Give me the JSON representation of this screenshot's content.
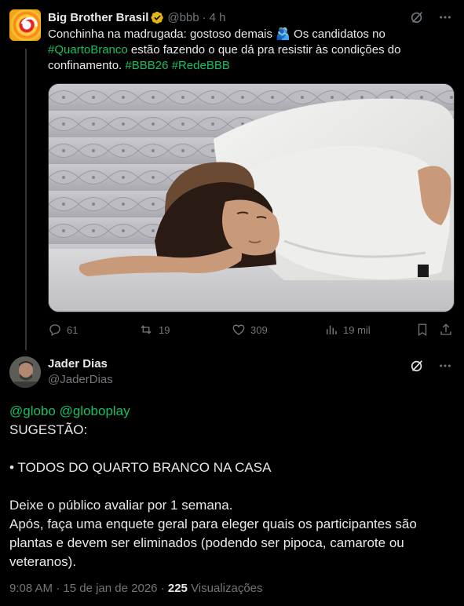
{
  "colors": {
    "background": "#000000",
    "text": "#e7e9ea",
    "muted": "#71767b",
    "hashtag": "#17bf63",
    "verified": "#e7b416"
  },
  "original_post": {
    "author_name": "Big Brother Brasil",
    "handle": "@bbb",
    "separator": "·",
    "time": "4 h",
    "text_1": "Conchinha na madrugada: gostoso demais ",
    "emoji": "🫂",
    "text_2": " Os candidatos no ",
    "hashtag_1": "#QuartoBranco",
    "text_3": " estão fazendo o que dá pra resistir às condições do confinamento. ",
    "hashtag_2": "#BBB26",
    "hashtag_3": "#RedeBBB",
    "icons": {
      "grok": "grok-icon",
      "more": "more-icon",
      "verified": "verified-badge-icon"
    },
    "media": {
      "alt": "photo"
    },
    "stats": {
      "replies": "61",
      "reposts": "19",
      "likes": "309",
      "views": "19 mil"
    }
  },
  "reply": {
    "author_name": "Jader Dias",
    "handle": "@JaderDias",
    "mention_1": "@globo",
    "mention_2": "@globoplay",
    "line_2": "SUGESTÃO:",
    "line_4": "• TODOS DO QUARTO BRANCO NA CASA",
    "line_6": "Deixe o público avaliar por 1 semana.",
    "line_7": "Após, faça uma enquete geral para eleger quais os participantes são plantas e devem ser eliminados (podendo ser pipoca, camarote ou veteranos)."
  },
  "meta": {
    "time": "9:08 AM",
    "separator": "·",
    "date": "15 de jan de 2026",
    "separator_2": "·",
    "views_count": "225",
    "views_label": "Visualizações"
  }
}
